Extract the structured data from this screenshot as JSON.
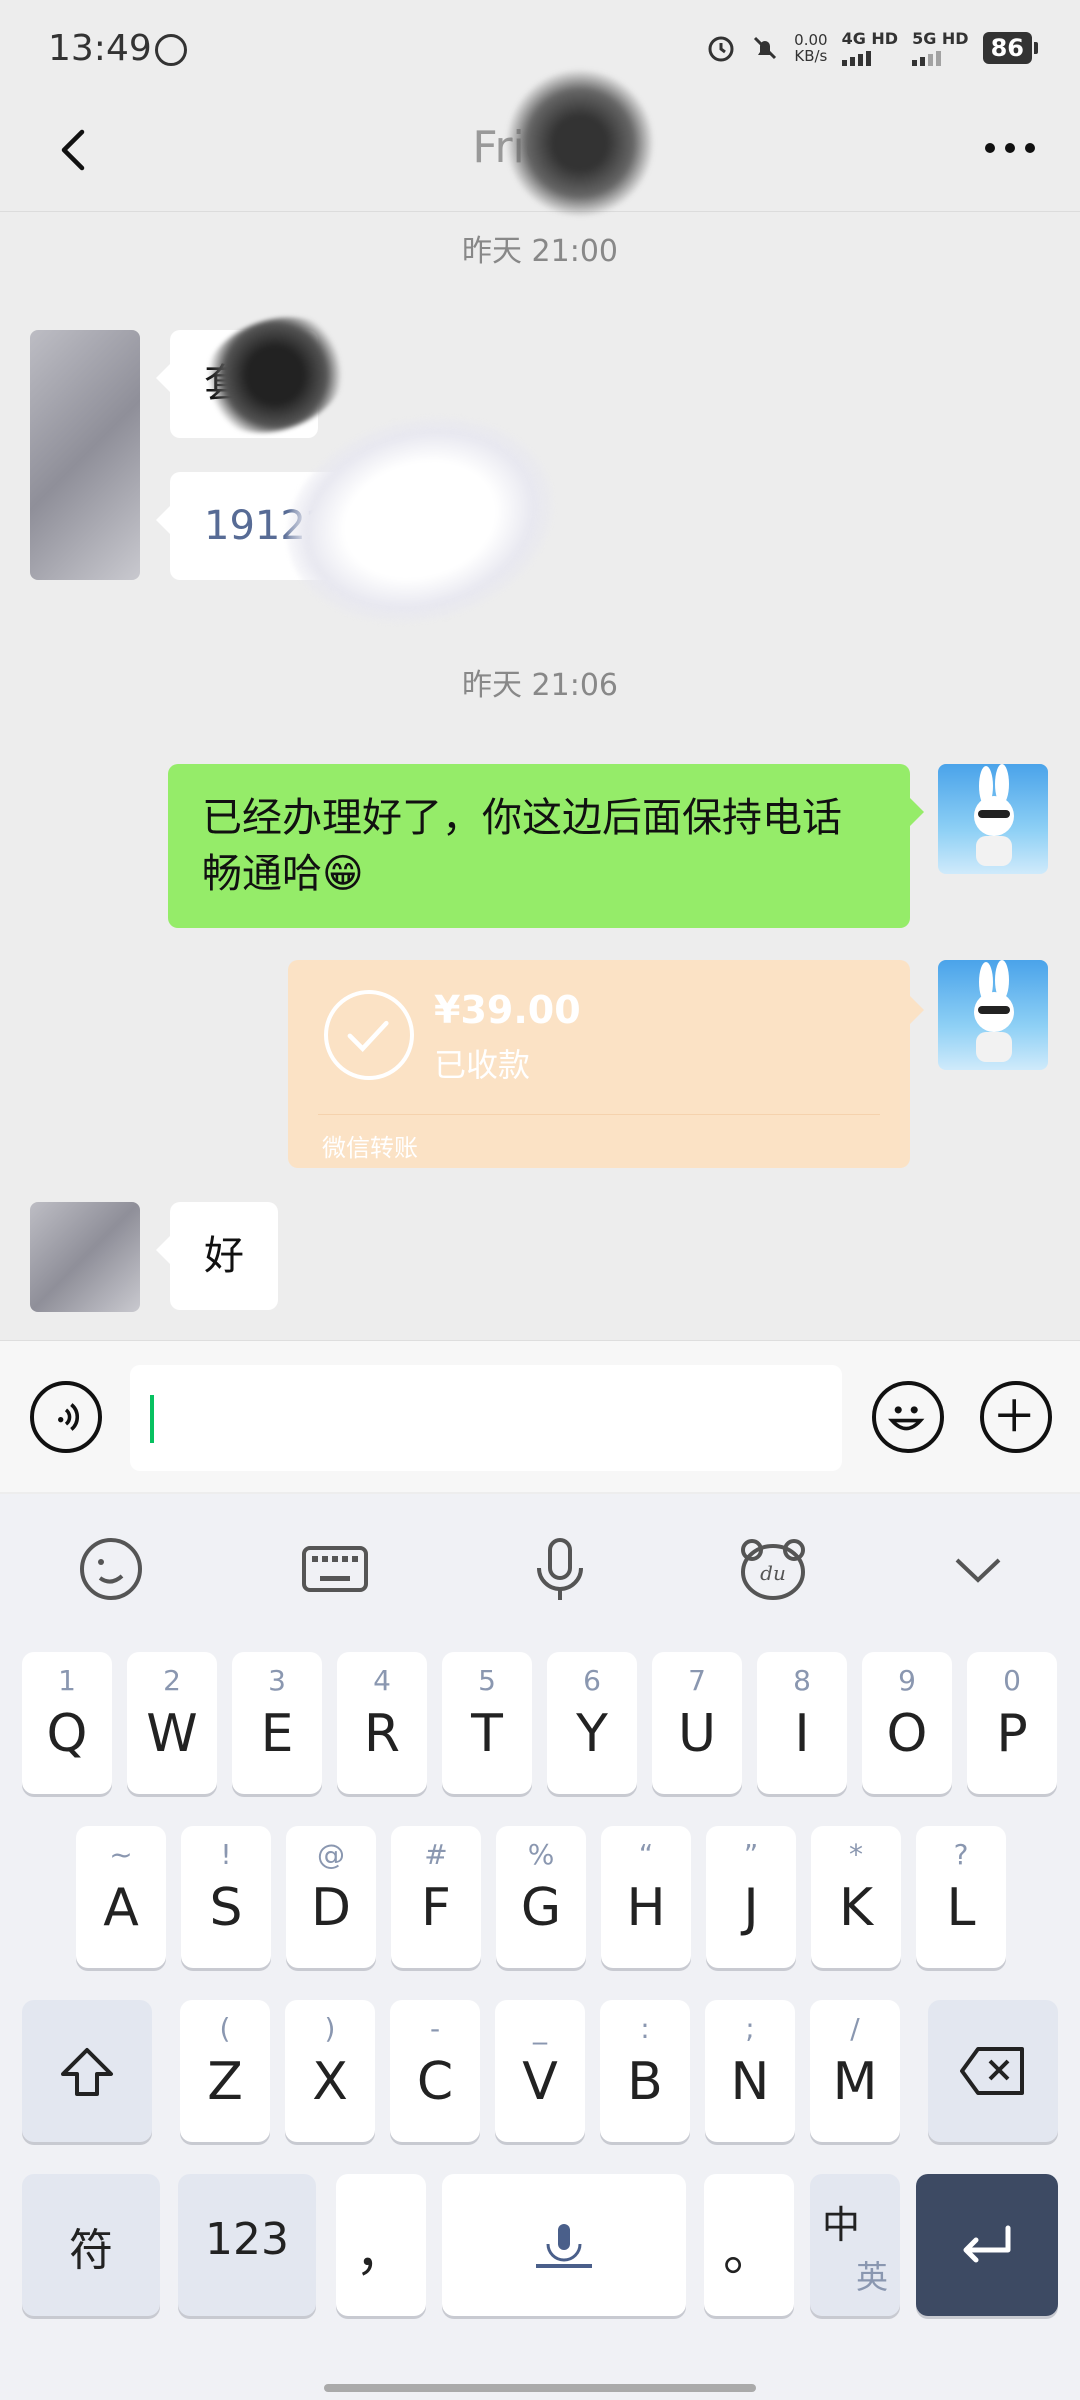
{
  "status": {
    "time": "13:49",
    "speed_value": "0.00",
    "speed_unit": "KB/s",
    "net1": "4G HD",
    "net2": "5G HD",
    "battery": "86"
  },
  "header": {
    "title": "Friend"
  },
  "chat": {
    "timestamps": [
      "昨天 21:00",
      "昨天 21:06"
    ],
    "msg1": "套准",
    "msg2": "191226",
    "msg3": "已经办理好了，你这边后面保持电话畅通哈😁",
    "transfer": {
      "amount": "¥39.00",
      "state": "已收款",
      "footer": "微信转账"
    },
    "msg4": "好"
  },
  "keyboard": {
    "row1": [
      {
        "sub": "1",
        "main": "Q"
      },
      {
        "sub": "2",
        "main": "W"
      },
      {
        "sub": "3",
        "main": "E"
      },
      {
        "sub": "4",
        "main": "R"
      },
      {
        "sub": "5",
        "main": "T"
      },
      {
        "sub": "6",
        "main": "Y"
      },
      {
        "sub": "7",
        "main": "U"
      },
      {
        "sub": "8",
        "main": "I"
      },
      {
        "sub": "9",
        "main": "O"
      },
      {
        "sub": "0",
        "main": "P"
      }
    ],
    "row2": [
      {
        "sub": "~",
        "main": "A"
      },
      {
        "sub": "!",
        "main": "S"
      },
      {
        "sub": "@",
        "main": "D"
      },
      {
        "sub": "#",
        "main": "F"
      },
      {
        "sub": "%",
        "main": "G"
      },
      {
        "sub": "“",
        "main": "H"
      },
      {
        "sub": "”",
        "main": "J"
      },
      {
        "sub": "*",
        "main": "K"
      },
      {
        "sub": "?",
        "main": "L"
      }
    ],
    "row3": [
      {
        "sub": "(",
        "main": "Z"
      },
      {
        "sub": ")",
        "main": "X"
      },
      {
        "sub": "-",
        "main": "C"
      },
      {
        "sub": "_",
        "main": "V"
      },
      {
        "sub": ":",
        "main": "B"
      },
      {
        "sub": ";",
        "main": "N"
      },
      {
        "sub": "/",
        "main": "M"
      }
    ],
    "symbols_label": "符",
    "numbers_label": "123",
    "comma": "，",
    "period": "。",
    "lang_top": "中",
    "lang_bottom": "英"
  },
  "colors": {
    "accent": "#07c160",
    "bubble_green": "#95ec69",
    "transfer": "#fbe2c5"
  }
}
